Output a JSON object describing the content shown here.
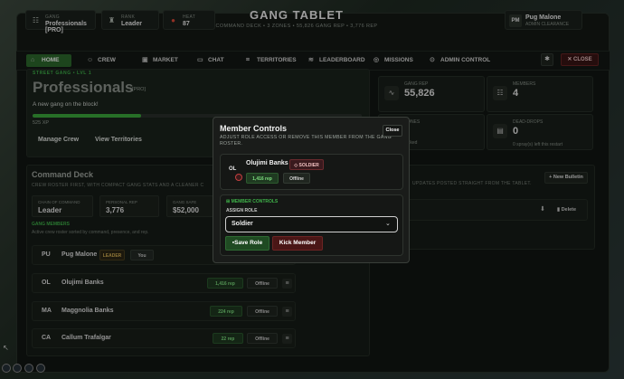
{
  "header": {
    "gang": {
      "label": "GANG",
      "value": "Professionals [PRO]",
      "icon": "users-icon"
    },
    "rank": {
      "label": "RANK",
      "value": "Leader",
      "icon": "rank-icon"
    },
    "heat": {
      "label": "HEAT",
      "value": "87",
      "icon": "fire-icon"
    },
    "title": "GANG TABLET",
    "subtitle": "COMMAND DECK • 3 ZONES • 55,826 GANG REP • 3,776 REP",
    "user": {
      "initials": "PM",
      "name": "Pug Malone",
      "role": "ADMIN CLEARANCE"
    }
  },
  "nav": {
    "tabs": [
      {
        "label": "HOME",
        "icon": "home-icon",
        "active": true
      },
      {
        "label": "CREW",
        "icon": "crew-icon"
      },
      {
        "label": "MARKET",
        "icon": "market-icon"
      },
      {
        "label": "CHAT",
        "icon": "chat-icon"
      },
      {
        "label": "TERRITORIES",
        "icon": "territories-icon"
      },
      {
        "label": "LEADERBOARD",
        "icon": "leaderboard-icon"
      },
      {
        "label": "MISSIONS",
        "icon": "missions-icon"
      },
      {
        "label": "ADMIN CONTROL",
        "icon": "admin-icon"
      }
    ],
    "close_label": "CLOSE"
  },
  "hero": {
    "kicker": "STREET GANG • LVL 1",
    "name": "Professionals",
    "tag": "[PRO]",
    "description": "A new gang on the block!",
    "xp_text": "525 XP",
    "xp_progress": 0.33,
    "manage_label": "Manage Crew",
    "territories_label": "View Territories"
  },
  "stats": {
    "gang_rep": {
      "label": "GANG REP",
      "value": "55,826"
    },
    "members": {
      "label": "MEMBERS",
      "value": "4"
    },
    "zones": {
      "label": "ZONES",
      "note": "locked"
    },
    "dead_drops": {
      "label": "DEAD-DROPS",
      "value": "0",
      "note": "0 spray(s) left this restart"
    }
  },
  "command": {
    "title": "Command Deck",
    "subtitle": "CREW ROSTER FIRST, WITH COMPACT GANG STATS AND A CLEANER C",
    "chain": {
      "label": "CHAIN OF COMMAND",
      "value": "Leader"
    },
    "personal_rep": {
      "label": "PERSONAL REP",
      "value": "3,776"
    },
    "gang_safe": {
      "label": "GANG SAFE",
      "value": "$52,000"
    },
    "members_title": "GANG MEMBERS",
    "members_sub": "Active crew roster sorted by command, presence, and rep.",
    "members": [
      {
        "initials": "PU",
        "name": "Pug Malone",
        "badge": "LEADER",
        "you": "You"
      },
      {
        "initials": "OL",
        "name": "Olujimi Banks",
        "rep": "1,416 rep",
        "status": "Offline"
      },
      {
        "initials": "MA",
        "name": "Maggnolia Banks",
        "rep": "224 rep",
        "status": "Offline"
      },
      {
        "initials": "CA",
        "name": "Callum Trafalgar",
        "rep": "22 rep",
        "status": "Offline"
      }
    ]
  },
  "bulletin": {
    "subtitle": "UPDATES POSTED STRAIGHT FROM THE TABLET.",
    "new_label": "+ New Bulletin",
    "delete_label": "Delete"
  },
  "modal": {
    "title": "Member Controls",
    "description": "ADJUST ROLE ACCESS OR REMOVE THIS MEMBER FROM THE GANG ROSTER.",
    "close_label": "Close",
    "member": {
      "initials": "OL",
      "name": "Olujimi Banks",
      "role": "SOLDIER",
      "rep": "1,416 rep",
      "status": "Offline"
    },
    "section_label": "MEMBER CONTROLS",
    "assign_label": "ASSIGN ROLE",
    "selected_role": "Soldier",
    "save_label": "Save Role",
    "kick_label": "Kick Member"
  },
  "colors": {
    "accent": "#2d6a2d",
    "danger": "#6a2424",
    "rep_text": "#7fe080",
    "leader": "#d9b255"
  }
}
